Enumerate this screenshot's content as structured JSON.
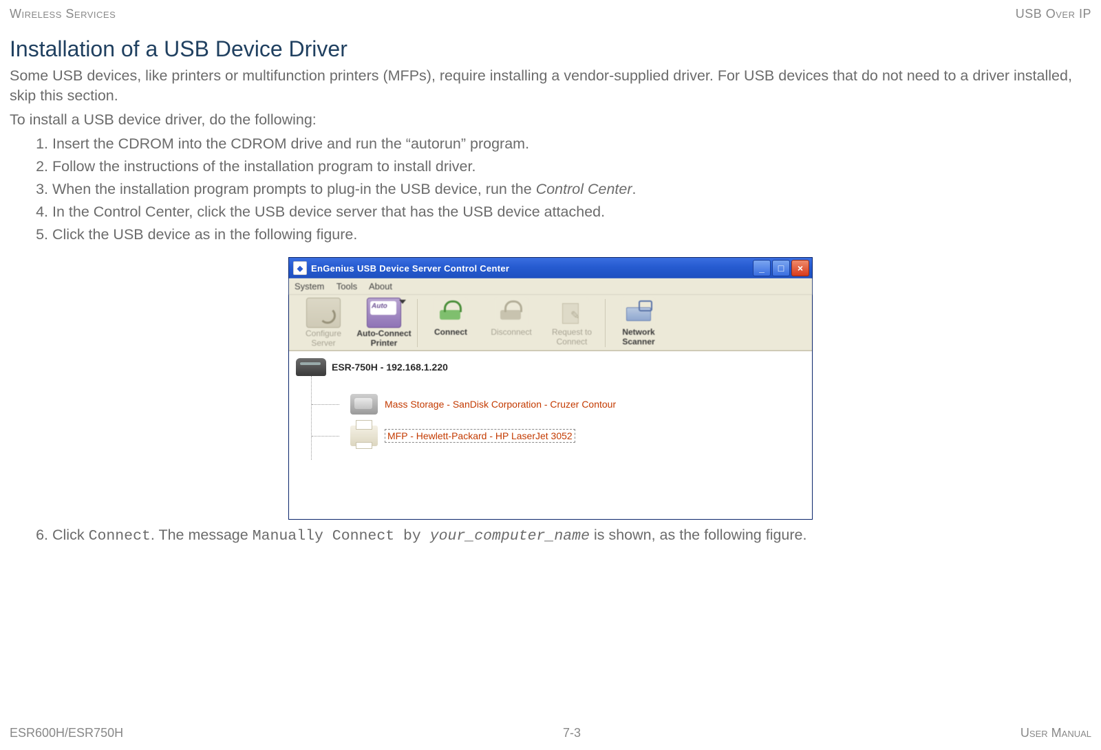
{
  "header": {
    "left": "Wireless Services",
    "right": "USB Over IP"
  },
  "title": "Installation of a USB Device Driver",
  "intro1": "Some USB devices, like printers or multifunction printers (MFPs), require installing a vendor-supplied driver. For USB devices that do not need to a driver installed, skip this section.",
  "intro2": "To install a USB device driver, do the following:",
  "steps": {
    "s1": "Insert the CDROM into the CDROM drive and run the “autorun” program.",
    "s2": "Follow the instructions of the installation program to install driver.",
    "s3a": "When the installation program prompts to plug-in the USB device, run the ",
    "s3b": "Control Center",
    "s3c": ".",
    "s4": "In the Control Center, click the USB device server that has the USB device attached.",
    "s5": "Click the USB device as in the following figure.",
    "s6a": "Click ",
    "s6b": "Connect",
    "s6c": ". The message ",
    "s6d": "Manually Connect by ",
    "s6e": "your_computer_name",
    "s6f": " is shown, as the following figure."
  },
  "window": {
    "title": "EnGenius USB Device Server Control Center",
    "menu": {
      "m1": "System",
      "m2": "Tools",
      "m3": "About"
    },
    "toolbar": {
      "configure1": "Configure",
      "configure2": "Server",
      "auto1": "Auto-Connect",
      "auto2": "Printer",
      "connect": "Connect",
      "disconnect": "Disconnect",
      "request1": "Request to",
      "request2": "Connect",
      "scanner1": "Network",
      "scanner2": "Scanner"
    },
    "tree": {
      "root": "ESR-750H - 192.168.1.220",
      "item1": "Mass Storage - SanDisk Corporation - Cruzer Contour",
      "item2": "MFP - Hewlett-Packard - HP LaserJet 3052"
    }
  },
  "footer": {
    "left": "ESR600H/ESR750H",
    "center": "7-3",
    "right": "User Manual"
  }
}
